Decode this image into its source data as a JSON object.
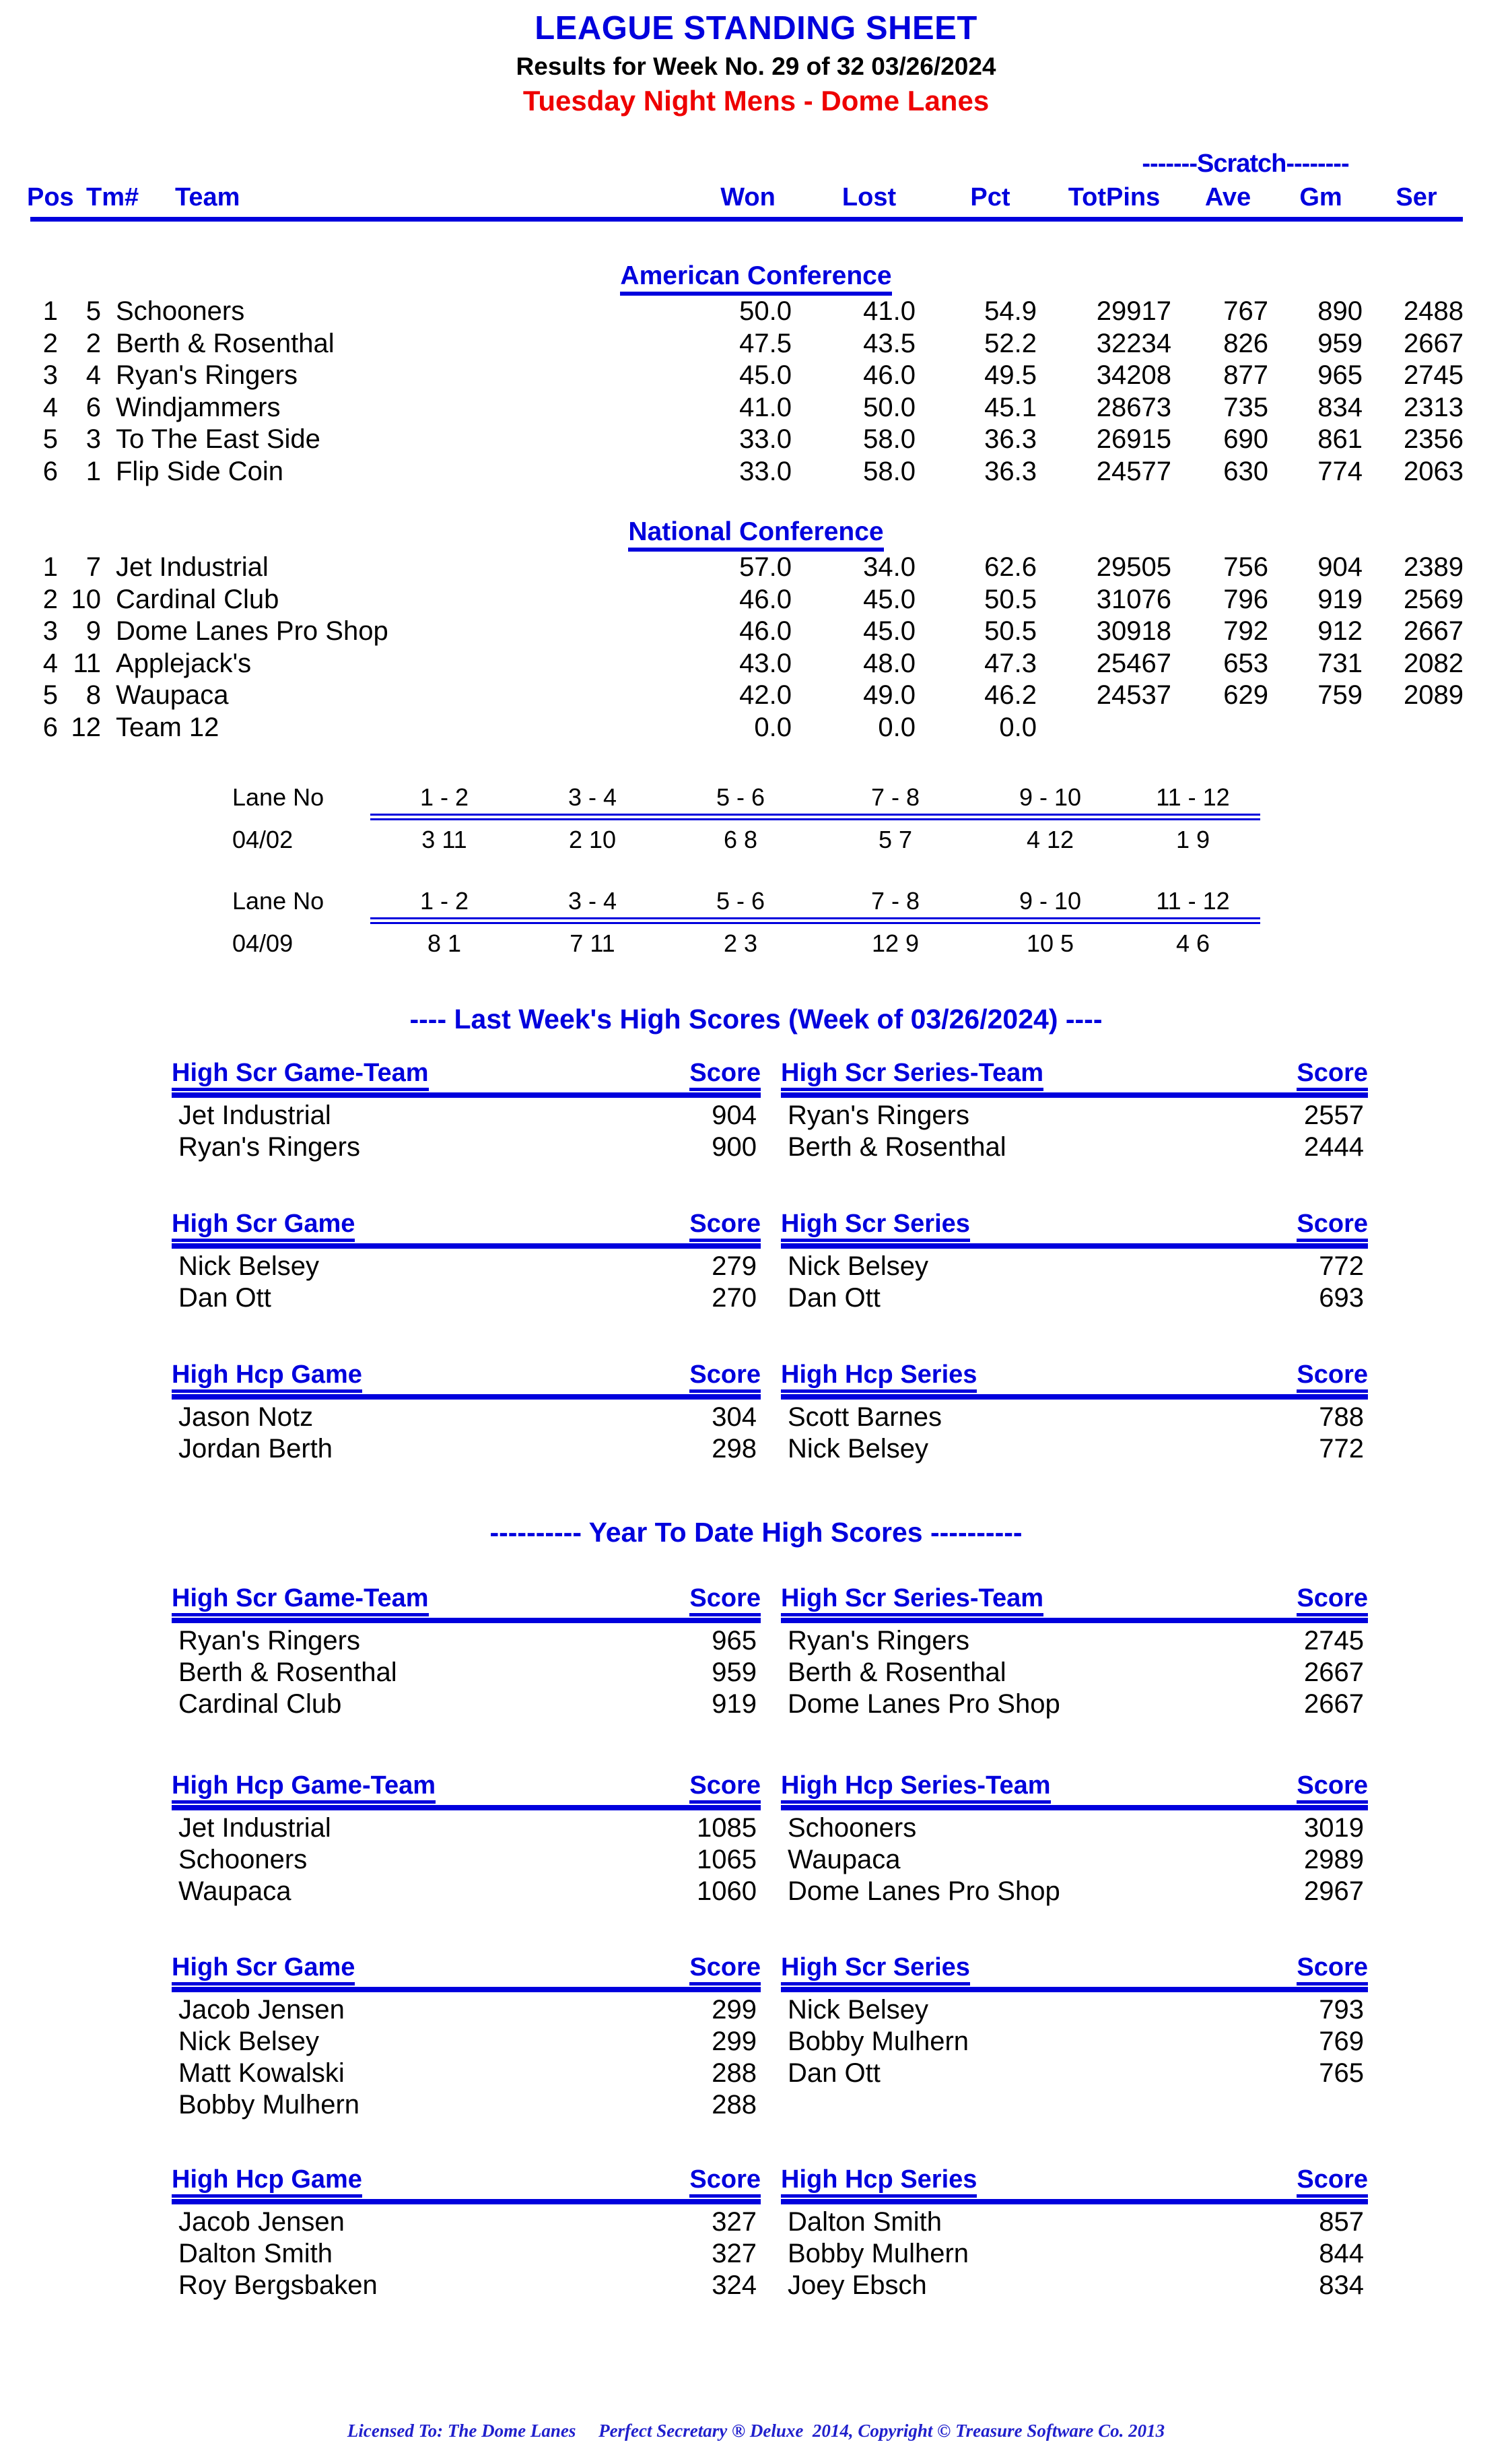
{
  "header": {
    "title": "LEAGUE STANDING SHEET",
    "results_line": "Results for Week No. 29 of 32    03/26/2024",
    "league_line": "Tuesday Night Mens - Dome Lanes"
  },
  "standings": {
    "scratch_group_label": "-------Scratch--------",
    "columns": {
      "pos": "Pos",
      "tm": "Tm#",
      "team": "Team",
      "won": "Won",
      "lost": "Lost",
      "pct": "Pct",
      "totpins": "TotPins",
      "ave": "Ave",
      "gm": "Gm",
      "ser": "Ser"
    },
    "conferences": [
      {
        "name": "American Conference",
        "rows": [
          {
            "pos": "1",
            "tm": "5",
            "team": "Schooners",
            "won": "50.0",
            "lost": "41.0",
            "pct": "54.9",
            "totpins": "29917",
            "ave": "767",
            "gm": "890",
            "ser": "2488"
          },
          {
            "pos": "2",
            "tm": "2",
            "team": "Berth & Rosenthal",
            "won": "47.5",
            "lost": "43.5",
            "pct": "52.2",
            "totpins": "32234",
            "ave": "826",
            "gm": "959",
            "ser": "2667"
          },
          {
            "pos": "3",
            "tm": "4",
            "team": "Ryan's Ringers",
            "won": "45.0",
            "lost": "46.0",
            "pct": "49.5",
            "totpins": "34208",
            "ave": "877",
            "gm": "965",
            "ser": "2745"
          },
          {
            "pos": "4",
            "tm": "6",
            "team": "Windjammers",
            "won": "41.0",
            "lost": "50.0",
            "pct": "45.1",
            "totpins": "28673",
            "ave": "735",
            "gm": "834",
            "ser": "2313"
          },
          {
            "pos": "5",
            "tm": "3",
            "team": "To The East Side",
            "won": "33.0",
            "lost": "58.0",
            "pct": "36.3",
            "totpins": "26915",
            "ave": "690",
            "gm": "861",
            "ser": "2356"
          },
          {
            "pos": "6",
            "tm": "1",
            "team": "Flip Side Coin",
            "won": "33.0",
            "lost": "58.0",
            "pct": "36.3",
            "totpins": "24577",
            "ave": "630",
            "gm": "774",
            "ser": "2063"
          }
        ]
      },
      {
        "name": "National Conference",
        "rows": [
          {
            "pos": "1",
            "tm": "7",
            "team": "Jet Industrial",
            "won": "57.0",
            "lost": "34.0",
            "pct": "62.6",
            "totpins": "29505",
            "ave": "756",
            "gm": "904",
            "ser": "2389"
          },
          {
            "pos": "2",
            "tm": "10",
            "team": "Cardinal Club",
            "won": "46.0",
            "lost": "45.0",
            "pct": "50.5",
            "totpins": "31076",
            "ave": "796",
            "gm": "919",
            "ser": "2569"
          },
          {
            "pos": "3",
            "tm": "9",
            "team": "Dome Lanes Pro Shop",
            "won": "46.0",
            "lost": "45.0",
            "pct": "50.5",
            "totpins": "30918",
            "ave": "792",
            "gm": "912",
            "ser": "2667"
          },
          {
            "pos": "4",
            "tm": "11",
            "team": "Applejack's",
            "won": "43.0",
            "lost": "48.0",
            "pct": "47.3",
            "totpins": "25467",
            "ave": "653",
            "gm": "731",
            "ser": "2082"
          },
          {
            "pos": "5",
            "tm": "8",
            "team": "Waupaca",
            "won": "42.0",
            "lost": "49.0",
            "pct": "46.2",
            "totpins": "24537",
            "ave": "629",
            "gm": "759",
            "ser": "2089"
          },
          {
            "pos": "6",
            "tm": "12",
            "team": "Team 12",
            "won": "0.0",
            "lost": "0.0",
            "pct": "0.0",
            "totpins": "",
            "ave": "",
            "gm": "",
            "ser": ""
          }
        ]
      }
    ]
  },
  "lane_schedule": {
    "label": "Lane No",
    "pairs": [
      "1 - 2",
      "3 - 4",
      "5 - 6",
      "7 - 8",
      "9 - 10",
      "11 - 12"
    ],
    "weeks": [
      {
        "date": "04/02",
        "matchups": [
          "3  11",
          "2  10",
          "6  8",
          "5  7",
          "4  12",
          "1  9"
        ]
      },
      {
        "date": "04/09",
        "matchups": [
          "8  1",
          "7  11",
          "2  3",
          "12  9",
          "10  5",
          "4  6"
        ]
      }
    ]
  },
  "last_week": {
    "banner": "----  Last Week's High Scores   (Week of 03/26/2024)  ----",
    "score_label": "Score",
    "blocks": [
      {
        "left": {
          "title": "High Scr Game-Team",
          "rows": [
            {
              "name": "Jet Industrial",
              "score": "904"
            },
            {
              "name": "Ryan's Ringers",
              "score": "900"
            }
          ]
        },
        "right": {
          "title": "High Scr Series-Team",
          "rows": [
            {
              "name": "Ryan's Ringers",
              "score": "2557"
            },
            {
              "name": "Berth & Rosenthal",
              "score": "2444"
            }
          ]
        }
      },
      {
        "left": {
          "title": "High Scr Game",
          "rows": [
            {
              "name": "Nick Belsey",
              "score": "279"
            },
            {
              "name": "Dan Ott",
              "score": "270"
            }
          ]
        },
        "right": {
          "title": "High Scr Series",
          "rows": [
            {
              "name": "Nick Belsey",
              "score": "772"
            },
            {
              "name": "Dan Ott",
              "score": "693"
            }
          ]
        }
      },
      {
        "left": {
          "title": "High Hcp Game",
          "rows": [
            {
              "name": "Jason Notz",
              "score": "304"
            },
            {
              "name": "Jordan Berth",
              "score": "298"
            }
          ]
        },
        "right": {
          "title": "High Hcp Series",
          "rows": [
            {
              "name": "Scott Barnes",
              "score": "788"
            },
            {
              "name": "Nick Belsey",
              "score": "772"
            }
          ]
        }
      }
    ]
  },
  "year_to_date": {
    "banner": "---------- Year To Date High Scores ----------",
    "score_label": "Score",
    "blocks": [
      {
        "left": {
          "title": "High Scr Game-Team",
          "rows": [
            {
              "name": "Ryan's Ringers",
              "score": "965"
            },
            {
              "name": "Berth & Rosenthal",
              "score": "959"
            },
            {
              "name": "Cardinal Club",
              "score": "919"
            }
          ]
        },
        "right": {
          "title": "High Scr Series-Team",
          "rows": [
            {
              "name": "Ryan's Ringers",
              "score": "2745"
            },
            {
              "name": "Berth & Rosenthal",
              "score": "2667"
            },
            {
              "name": "Dome Lanes Pro Shop",
              "score": "2667"
            }
          ]
        }
      },
      {
        "left": {
          "title": "High Hcp Game-Team",
          "rows": [
            {
              "name": "Jet Industrial",
              "score": "1085"
            },
            {
              "name": "Schooners",
              "score": "1065"
            },
            {
              "name": "Waupaca",
              "score": "1060"
            }
          ]
        },
        "right": {
          "title": "High Hcp Series-Team",
          "rows": [
            {
              "name": "Schooners",
              "score": "3019"
            },
            {
              "name": "Waupaca",
              "score": "2989"
            },
            {
              "name": "Dome Lanes Pro Shop",
              "score": "2967"
            }
          ]
        }
      },
      {
        "left": {
          "title": "High Scr Game",
          "rows": [
            {
              "name": "Jacob Jensen",
              "score": "299"
            },
            {
              "name": "Nick Belsey",
              "score": "299"
            },
            {
              "name": "Matt Kowalski",
              "score": "288"
            },
            {
              "name": "Bobby Mulhern",
              "score": "288"
            }
          ]
        },
        "right": {
          "title": "High Scr Series",
          "rows": [
            {
              "name": "Nick Belsey",
              "score": "793"
            },
            {
              "name": "Bobby Mulhern",
              "score": "769"
            },
            {
              "name": "Dan Ott",
              "score": "765"
            }
          ]
        }
      },
      {
        "left": {
          "title": "High Hcp Game",
          "rows": [
            {
              "name": "Jacob Jensen",
              "score": "327"
            },
            {
              "name": "Dalton Smith",
              "score": "327"
            },
            {
              "name": "Roy Bergsbaken",
              "score": "324"
            }
          ]
        },
        "right": {
          "title": "High Hcp Series",
          "rows": [
            {
              "name": "Dalton Smith",
              "score": "857"
            },
            {
              "name": "Bobby Mulhern",
              "score": "844"
            },
            {
              "name": "Joey Ebsch",
              "score": "834"
            }
          ]
        }
      }
    ]
  },
  "footer": {
    "text": "Licensed To: The Dome Lanes     Perfect Secretary ® Deluxe  2014, Copyright © Treasure Software Co. 2013"
  },
  "colors": {
    "blue": "#0000dd",
    "red": "#ee0000",
    "black": "#000000"
  }
}
